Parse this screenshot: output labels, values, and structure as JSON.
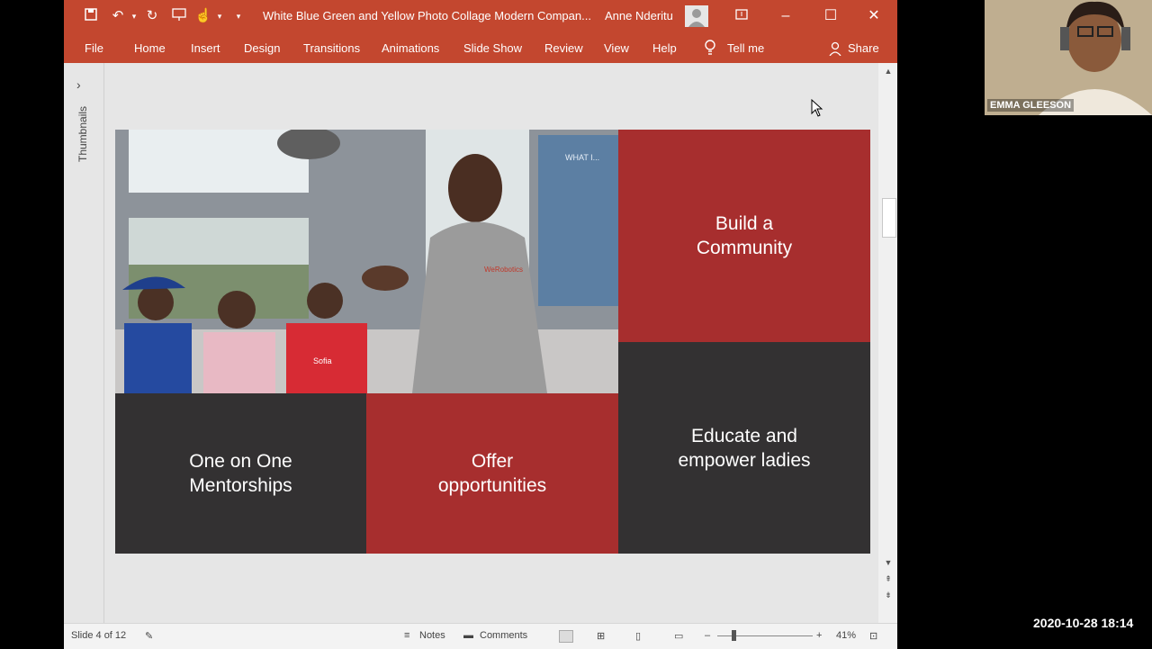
{
  "window": {
    "title": "White Blue Green and Yellow Photo Collage Modern Compan...",
    "user": "Anne  Nderitu"
  },
  "ribbon": {
    "tabs": [
      "File",
      "Home",
      "Insert",
      "Design",
      "Transitions",
      "Animations",
      "Slide Show",
      "Review",
      "View",
      "Help"
    ],
    "tell_me": "Tell me",
    "share": "Share"
  },
  "thumbnails_label": "Thumbnails",
  "slide": {
    "tiles": {
      "build": "Build a Community",
      "educate": "Educate and empower ladies",
      "mentor": "One on One Mentorships",
      "offer": "Offer opportunities"
    },
    "screen_text": "WHAT I...",
    "shirt_text": "WeRobotics",
    "cap_text": "Sofia"
  },
  "status": {
    "slide_info": "Slide 4 of 12",
    "notes": "Notes",
    "comments": "Comments",
    "zoom": "41%"
  },
  "video": {
    "participant": "EMMA GLEESON"
  },
  "timestamp": "2020-10-28  18:14",
  "colors": {
    "accent": "#c3472f",
    "tile_red": "#a72e2e",
    "tile_dark": "#333132"
  }
}
